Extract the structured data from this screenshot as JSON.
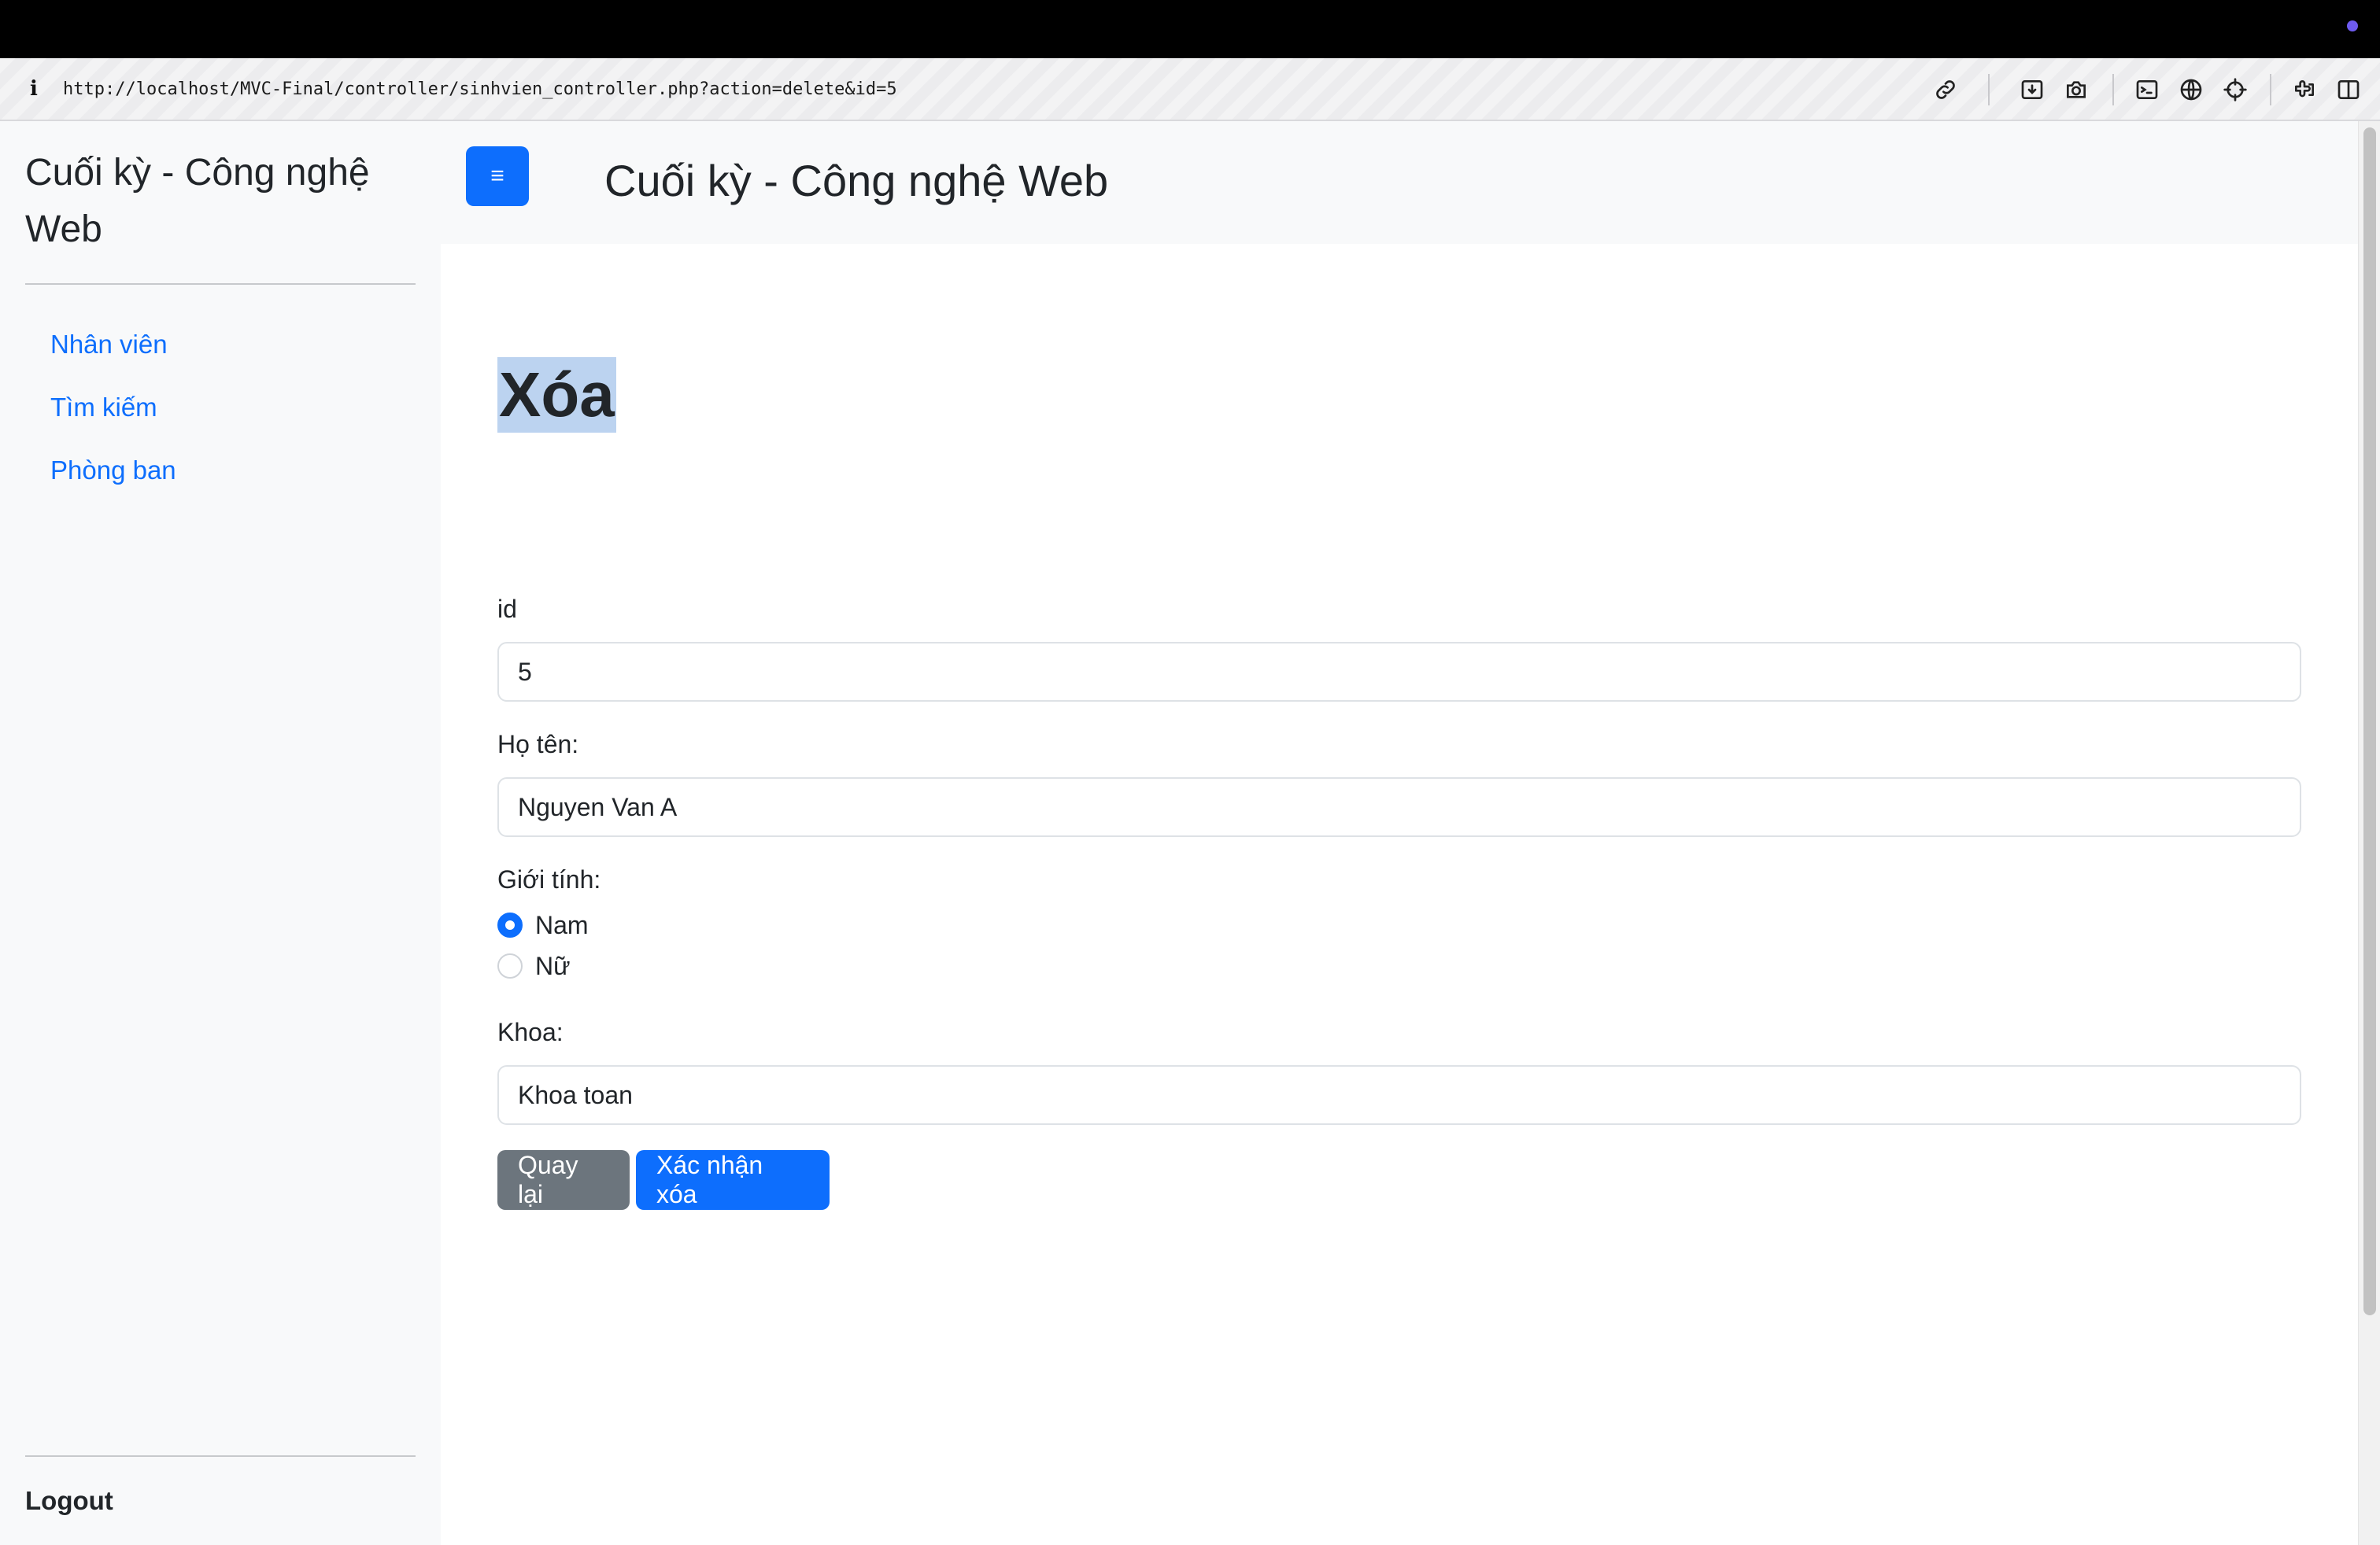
{
  "browser": {
    "url": "http://localhost/MVC-Final/controller/sinhvien_controller.php?action=delete&id=5",
    "info_glyph": "i",
    "toolbar_icons": [
      "link-icon",
      "download-icon",
      "camera-icon",
      "terminal-icon",
      "globe-icon",
      "crosshair-icon",
      "extension-icon",
      "sidebar-icon"
    ]
  },
  "sidebar": {
    "brand": "Cuối kỳ - Công nghệ Web",
    "items": [
      {
        "label": "Nhân viên"
      },
      {
        "label": "Tìm kiếm"
      },
      {
        "label": "Phòng ban"
      }
    ],
    "logout": "Logout"
  },
  "header": {
    "toggle_glyph": "≡",
    "title": "Cuối kỳ - Công nghệ Web"
  },
  "form": {
    "heading": "Xóa",
    "id_label": "id",
    "id_value": "5",
    "name_label": "Họ tên:",
    "name_value": "Nguyen Van A",
    "gender_label": "Giới tính:",
    "gender_options": [
      {
        "label": "Nam",
        "checked": true
      },
      {
        "label": "Nữ",
        "checked": false
      }
    ],
    "faculty_label": "Khoa:",
    "faculty_value": "Khoa toan",
    "back_button": "Quay lại",
    "confirm_button": "Xác nhận xóa"
  },
  "colors": {
    "primary": "#0d6efd",
    "secondary": "#6c757d",
    "sidebar_bg": "#f8f9fa",
    "selection": "#bcd3f0"
  }
}
